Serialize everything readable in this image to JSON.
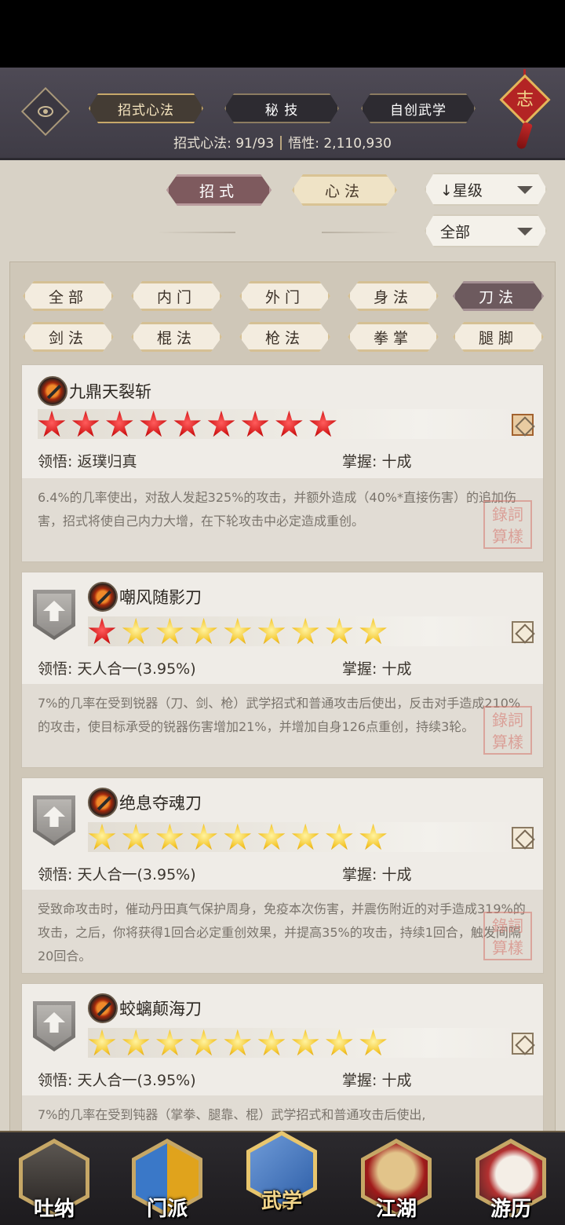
{
  "header": {
    "tabs": [
      {
        "label": "招式心法",
        "active": true
      },
      {
        "label": "秘 技",
        "active": false
      },
      {
        "label": "自创武学",
        "active": false
      }
    ],
    "ornament_char": "志",
    "stats": {
      "skills_label": "招式心法: 91/93",
      "insight_label": "悟性: 2,110,930"
    }
  },
  "filters": {
    "mode_tabs": [
      {
        "label": "招式",
        "active": true
      },
      {
        "label": "心法",
        "active": false
      }
    ],
    "sort_select": "↓星级",
    "scope_select": "全部"
  },
  "categories": [
    {
      "label": "全部",
      "active": false
    },
    {
      "label": "内门",
      "active": false
    },
    {
      "label": "外门",
      "active": false
    },
    {
      "label": "身法",
      "active": false
    },
    {
      "label": "刀法",
      "active": true
    },
    {
      "label": "剑法",
      "active": false
    },
    {
      "label": "棍法",
      "active": false
    },
    {
      "label": "枪法",
      "active": false
    },
    {
      "label": "拳掌",
      "active": false
    },
    {
      "label": "腿脚",
      "active": false
    }
  ],
  "cards": [
    {
      "name": "九鼎天裂斩",
      "stars": 9,
      "red_stars": 9,
      "insight_label": "领悟:",
      "insight_value": "返璞归真",
      "mastery_label": "掌握:",
      "mastery_value": "十成",
      "description": "6.4%的几率使出，对敌人发起325%的攻击，并额外造成（40%*直接伤害）的追加伤害，招式将使自己内力大增，在下轮攻击中必定造成重创。",
      "seal_text": "錄詞 算樣",
      "has_upgrade": false
    },
    {
      "name": "嘲风随影刀",
      "stars": 9,
      "red_stars": 1,
      "insight_label": "领悟:",
      "insight_value": "天人合一(3.95%)",
      "mastery_label": "掌握:",
      "mastery_value": "十成",
      "description": "7%的几率在受到锐器（刀、剑、枪）武学招式和普通攻击后使出，反击对手造成210%的攻击，使目标承受的锐器伤害增加21%，并增加自身126点重创，持续3轮。",
      "seal_text": "錄詞 算樣",
      "has_upgrade": true
    },
    {
      "name": "绝息夺魂刀",
      "stars": 9,
      "red_stars": 0,
      "insight_label": "领悟:",
      "insight_value": "天人合一(3.95%)",
      "mastery_label": "掌握:",
      "mastery_value": "十成",
      "description": "受致命攻击时，催动丹田真气保护周身，免疫本次伤害，并震伤附近的对手造成319%的攻击，之后，你将获得1回合必定重创效果，并提高35%的攻击，持续1回合，触发间隔20回合。",
      "seal_text": "錄詞 算樣",
      "has_upgrade": true
    },
    {
      "name": "蛟螭颠海刀",
      "stars": 9,
      "red_stars": 0,
      "insight_label": "领悟:",
      "insight_value": "天人合一(3.95%)",
      "mastery_label": "掌握:",
      "mastery_value": "十成",
      "description": "7%的几率在受到钝器（掌拳、腿靠、棍）武学招式和普通攻击后使出,",
      "seal_text": "",
      "has_upgrade": true
    }
  ],
  "bottom_nav": [
    {
      "label": "吐纳",
      "active": false,
      "icon": "meditating-figure-icon"
    },
    {
      "label": "门派",
      "active": false,
      "icon": "sect-banner-icon"
    },
    {
      "label": "武学",
      "active": true,
      "icon": "martial-book-icon"
    },
    {
      "label": "江湖",
      "active": false,
      "icon": "straw-hat-icon"
    },
    {
      "label": "游历",
      "active": false,
      "icon": "horse-icon"
    }
  ],
  "colors": {
    "header_bg": "#4a4651",
    "active_tab": "#7e5a5e",
    "red_star": "#d01515",
    "gold_star": "#f4c52a"
  }
}
